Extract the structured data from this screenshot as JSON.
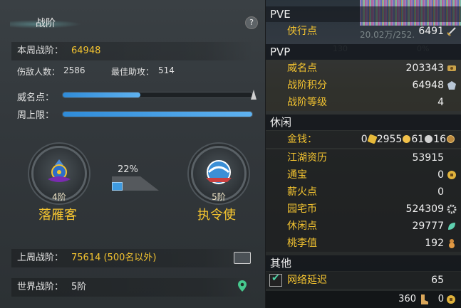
{
  "left": {
    "title": "战阶",
    "help": "?",
    "this_week_label": "本周战阶：",
    "this_week_value": "64948",
    "kills_label": "伤敌人数：",
    "kills_value": "2586",
    "assists_label": "最佳助攻：",
    "assists_value": "514",
    "fame_label": "威名点：",
    "fame_progress": 0.41,
    "cap_label": "周上限：",
    "cap_progress": 1.0,
    "medal_left": {
      "rank": "4阶",
      "name": "落雁客"
    },
    "medal_right": {
      "rank": "5阶",
      "name": "执令使"
    },
    "progress_pct": "22%",
    "last_week_label": "上周战阶：",
    "last_week_value": "75614 (500名以外)",
    "world_label": "世界战阶：",
    "world_value": "5阶"
  },
  "right": {
    "pve_header": "PVE",
    "pvp_header": "PVP",
    "leisure_header": "休闲",
    "other_header": "其他",
    "pve": [
      {
        "label": "侠行点",
        "value": "6491"
      }
    ],
    "pvp": [
      {
        "label": "威名点",
        "value": "203343"
      },
      {
        "label": "战阶积分",
        "value": "64948"
      },
      {
        "label": "战阶等级",
        "value": "4"
      }
    ],
    "money": {
      "label": "金钱：",
      "zhuan": "0",
      "jin": "2955",
      "yin": "61",
      "tong": "16"
    },
    "leisure": [
      {
        "label": "江湖资历",
        "value": "53915"
      },
      {
        "label": "通宝",
        "value": "0"
      },
      {
        "label": "薪火点",
        "value": "0"
      },
      {
        "label": "园宅币",
        "value": "524309"
      },
      {
        "label": "休闲点",
        "value": "29777"
      },
      {
        "label": "桃李值",
        "value": "192"
      }
    ],
    "other": [
      {
        "label": "网络延迟",
        "value": "65",
        "checked": true
      }
    ],
    "footer": {
      "value1": "360",
      "value2": "0"
    },
    "overlay_text": {
      "big": "20.02万/252.",
      "lvl": "130",
      "pct": "0%"
    }
  }
}
